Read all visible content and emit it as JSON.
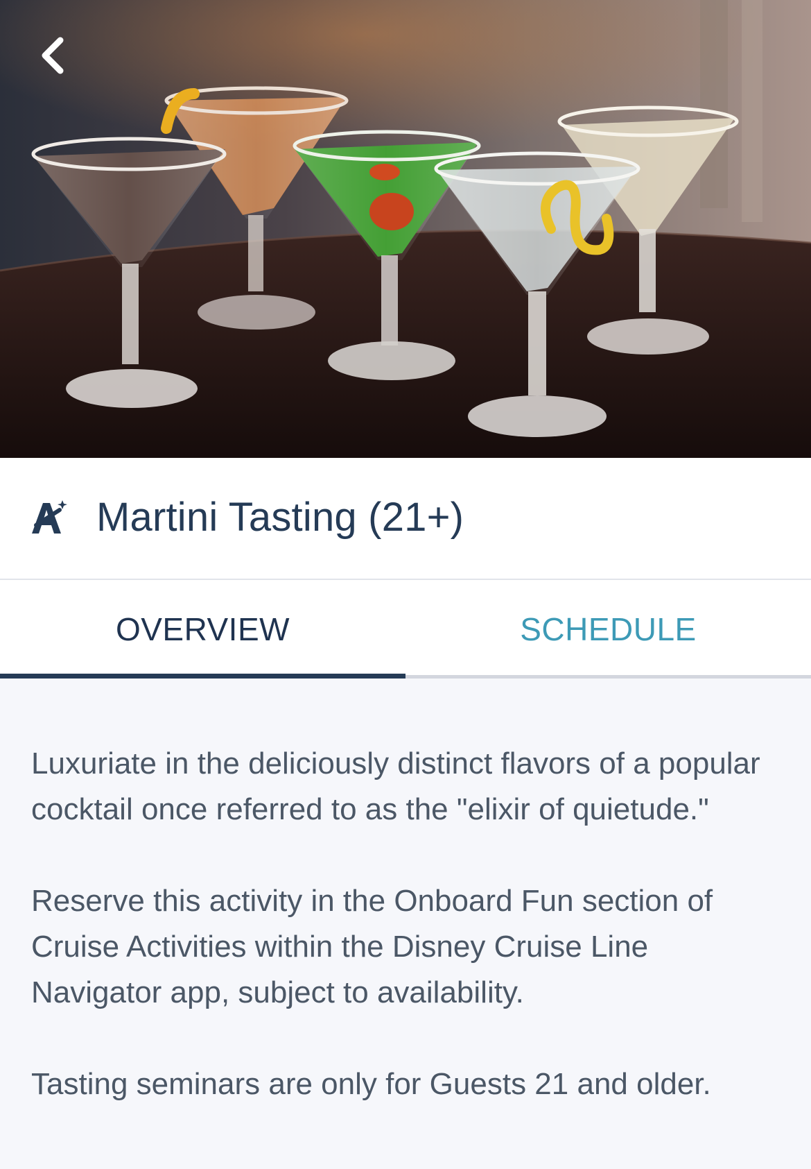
{
  "activity": {
    "title": "Martini Tasting (21+)",
    "icon": "magic-wand-a-icon"
  },
  "hero_image": {
    "alt": "Five martini glasses with colorful cocktails and lemon twists"
  },
  "tabs": [
    {
      "label": "OVERVIEW",
      "active": true
    },
    {
      "label": "SCHEDULE",
      "active": false
    }
  ],
  "overview": {
    "paragraphs": [
      "Luxuriate in the deliciously distinct flavors of a popular cocktail once referred to as the \"elixir of quietude.\"",
      "Reserve this activity in the Onboard Fun section of Cruise Activities within the Disney Cruise Line Navigator app, subject to availability.",
      "Tasting seminars are only for Guests 21 and older."
    ]
  },
  "colors": {
    "title": "#253b56",
    "tab_active": "#1f3350",
    "tab_inactive": "#3d9ab6",
    "body_text": "#4b5766",
    "background": "#f6f7fb"
  }
}
